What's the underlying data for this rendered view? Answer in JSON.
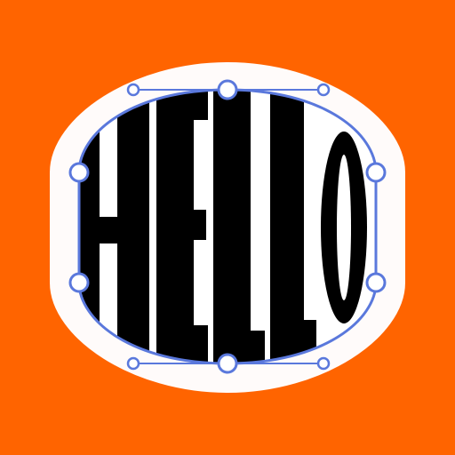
{
  "icon": {
    "name": "text-envelope-warp-icon",
    "word": "HELLO",
    "colors": {
      "background": "#ff6400",
      "sticker_outline": "#ffffff",
      "shape_fill": "#ffffff",
      "text": "#000000",
      "path_stroke": "#5a78dc",
      "handle_fill": "#ffffff"
    }
  }
}
